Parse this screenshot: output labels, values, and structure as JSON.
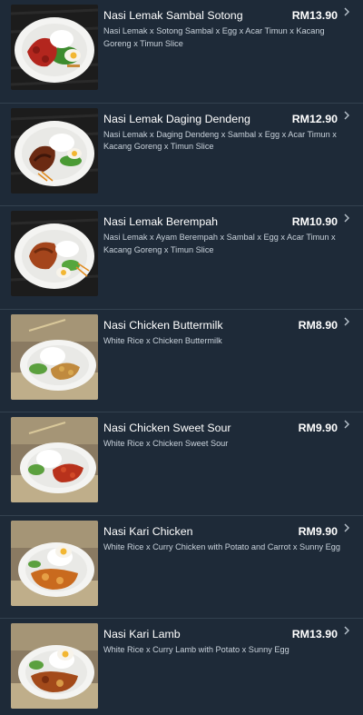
{
  "menu": {
    "items": [
      {
        "name": "Nasi Lemak Sambal Sotong",
        "price": "RM13.90",
        "description": "Nasi Lemak x Sotong Sambal x Egg x Acar Timun x Kacang Goreng x Timun Slice",
        "image": "nasi-lemak-sambal-sotong-photo"
      },
      {
        "name": "Nasi Lemak Daging Dendeng",
        "price": "RM12.90",
        "description": "Nasi Lemak x Daging Dendeng x Sambal x Egg x Acar Timun x Kacang Goreng x Timun Slice",
        "image": "nasi-lemak-daging-dendeng-photo"
      },
      {
        "name": "Nasi Lemak Berempah",
        "price": "RM10.90",
        "description": "Nasi Lemak x Ayam Berempah x Sambal x Egg x Acar Timun x Kacang Goreng x Timun Slice",
        "image": "nasi-lemak-berempah-photo"
      },
      {
        "name": "Nasi Chicken Buttermilk",
        "price": "RM8.90",
        "description": "White Rice x Chicken Buttermilk",
        "image": "nasi-chicken-buttermilk-photo"
      },
      {
        "name": "Nasi Chicken Sweet Sour",
        "price": "RM9.90",
        "description": "White Rice x Chicken Sweet Sour",
        "image": "nasi-chicken-sweet-sour-photo"
      },
      {
        "name": "Nasi Kari Chicken",
        "price": "RM9.90",
        "description": "White Rice x Curry Chicken with Potato and Carrot x Sunny Egg",
        "image": "nasi-kari-chicken-photo"
      },
      {
        "name": "Nasi Kari Lamb",
        "price": "RM13.90",
        "description": "White Rice x Curry Lamb with Potato x Sunny Egg",
        "image": "nasi-kari-lamb-photo"
      }
    ]
  },
  "colors": {
    "background": "#1e2a38",
    "divider": "#33414f",
    "text_primary": "#ffffff",
    "text_secondary": "#c9d2db"
  },
  "icons": {
    "item_arrow": "chevron-right-icon"
  }
}
